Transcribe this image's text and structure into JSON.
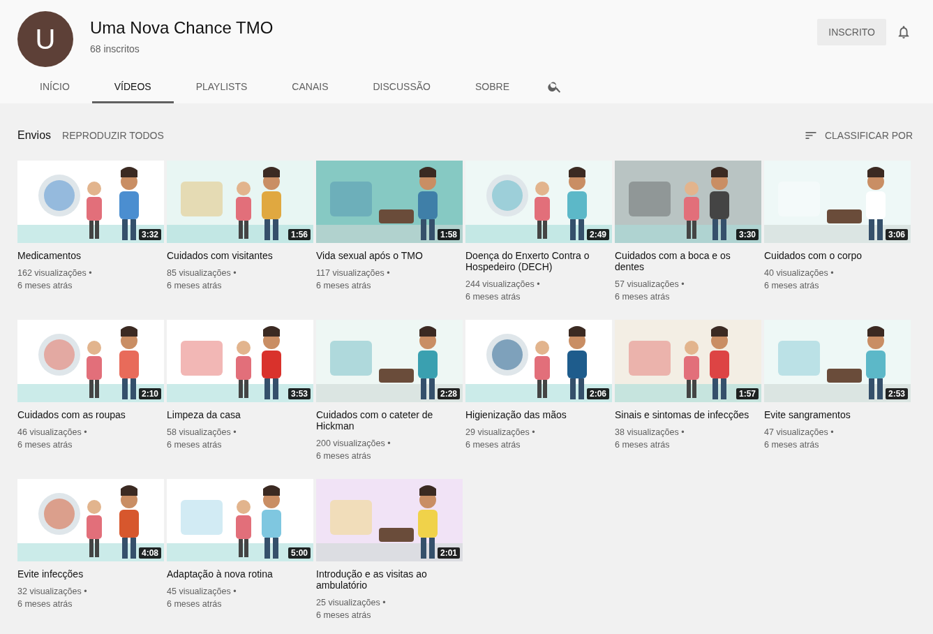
{
  "channel": {
    "avatar_letter": "U",
    "name": "Uma Nova Chance TMO",
    "subscribers": "68 inscritos",
    "subscribe_button": "INSCRITO"
  },
  "tabs": [
    {
      "label": "INÍCIO",
      "selected": false
    },
    {
      "label": "VÍDEOS",
      "selected": true
    },
    {
      "label": "PLAYLISTS",
      "selected": false
    },
    {
      "label": "CANAIS",
      "selected": false
    },
    {
      "label": "DISCUSSÃO",
      "selected": false
    },
    {
      "label": "SOBRE",
      "selected": false
    }
  ],
  "section": {
    "title": "Envios",
    "play_all": "REPRODUZIR TODOS",
    "sort": "CLASSIFICAR POR"
  },
  "videos": [
    {
      "title": "Medicamentos",
      "duration": "3:32",
      "views": "162 visualizações •",
      "age": "6 meses atrás"
    },
    {
      "title": "Cuidados com visitantes",
      "duration": "1:56",
      "views": "85 visualizações •",
      "age": "6 meses atrás"
    },
    {
      "title": "Vida sexual após o TMO",
      "duration": "1:58",
      "views": "117 visualizações •",
      "age": "6 meses atrás"
    },
    {
      "title": "Doença do Enxerto Contra o Hospedeiro (DECH)",
      "duration": "2:49",
      "views": "244 visualizações •",
      "age": "6 meses atrás"
    },
    {
      "title": "Cuidados com a boca e os dentes",
      "duration": "3:30",
      "views": "57 visualizações •",
      "age": "6 meses atrás"
    },
    {
      "title": "Cuidados com o corpo",
      "duration": "3:06",
      "views": "40 visualizações •",
      "age": "6 meses atrás"
    },
    {
      "title": "Cuidados com as roupas",
      "duration": "2:10",
      "views": "46 visualizações •",
      "age": "6 meses atrás"
    },
    {
      "title": "Limpeza da casa",
      "duration": "3:53",
      "views": "58 visualizações •",
      "age": "6 meses atrás"
    },
    {
      "title": "Cuidados com o cateter de Hickman",
      "duration": "2:28",
      "views": "200 visualizações •",
      "age": "6 meses atrás"
    },
    {
      "title": "Higienização das mãos",
      "duration": "2:06",
      "views": "29 visualizações •",
      "age": "6 meses atrás"
    },
    {
      "title": "Sinais e sintomas de infecções",
      "duration": "1:57",
      "views": "38 visualizações •",
      "age": "6 meses atrás"
    },
    {
      "title": "Evite sangramentos",
      "duration": "2:53",
      "views": "47 visualizações •",
      "age": "6 meses atrás"
    },
    {
      "title": "Evite infecções",
      "duration": "4:08",
      "views": "32 visualizações •",
      "age": "6 meses atrás"
    },
    {
      "title": "Adaptação à nova rotina",
      "duration": "5:00",
      "views": "45 visualizações •",
      "age": "6 meses atrás"
    },
    {
      "title": "Introdução e as visitas ao ambulatório",
      "duration": "2:01",
      "views": "25 visualizações •",
      "age": "6 meses atrás"
    }
  ]
}
